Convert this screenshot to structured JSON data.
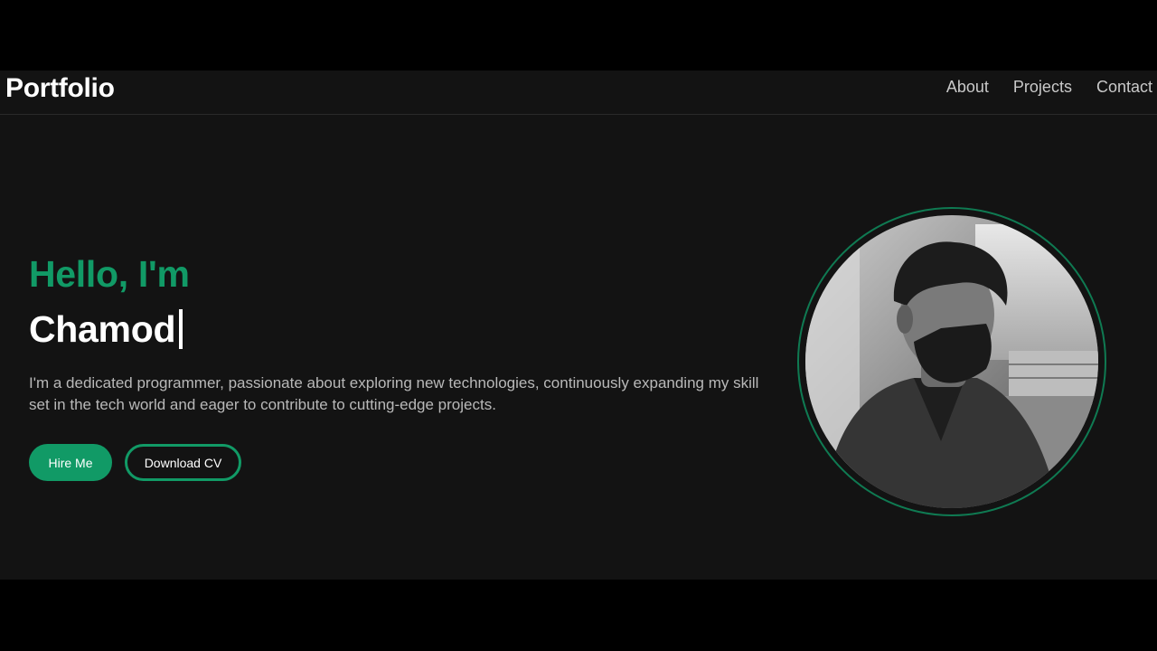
{
  "nav": {
    "brand": "Portfolio",
    "links": [
      "About",
      "Projects",
      "Contact"
    ]
  },
  "hero": {
    "greeting": "Hello, I'm",
    "name": "Chamod",
    "bio": "I'm a dedicated programmer, passionate about exploring new technologies, continuously expanding my skill set in the tech world and eager to contribute to cutting-edge projects.",
    "primary_button": "Hire Me",
    "secondary_button": "Download CV"
  },
  "colors": {
    "accent": "#119a66",
    "background": "#131313",
    "text": "#ffffff",
    "muted_text": "#b9b9b9"
  }
}
